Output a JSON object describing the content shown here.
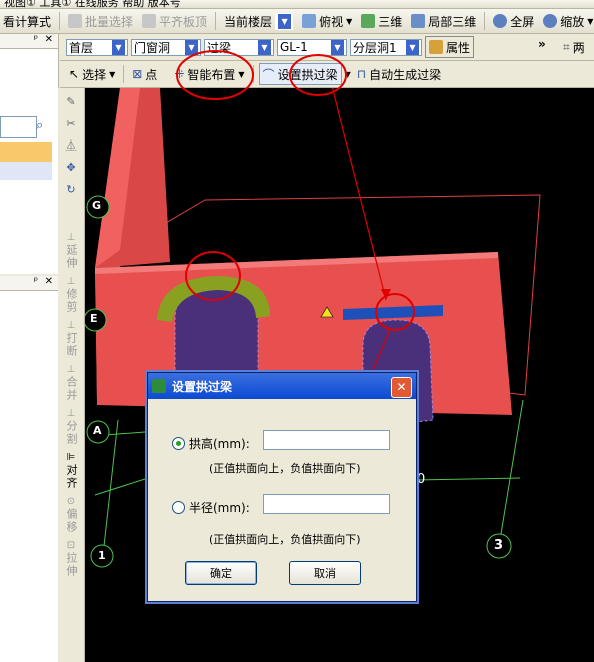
{
  "menu": {
    "text": "视图①  工具①  在线服务  帮助 版本号"
  },
  "toolbar1": {
    "calc_label": "看计算式",
    "batch_select": "批量选择",
    "level_slab": "平齐板顶",
    "floor_combo": "当前楼层",
    "view_label": "俯视",
    "view3d_label": "三维",
    "partial3d_label": "局部三维",
    "fullscreen_label": "全屏",
    "zoom_label": "缩放"
  },
  "toolbar2": {
    "floor": "首层",
    "category": "门窗洞",
    "element_type": "过梁",
    "element_name": "GL-1",
    "layer": "分层洞1",
    "props_label": "属性",
    "two_label": "两"
  },
  "toolbar3": {
    "select_label": "选择",
    "point_label": "点",
    "smart_place_label": "智能布置",
    "arch_beam_label": "设置拱过梁",
    "auto_gen_label": "自动生成过梁"
  },
  "side_tools": [
    {
      "label": "延伸",
      "active": false
    },
    {
      "label": "修剪",
      "active": false
    },
    {
      "label": "打断",
      "active": false
    },
    {
      "label": "合并",
      "active": false
    },
    {
      "label": "分割",
      "active": false
    },
    {
      "label": "对齐",
      "active": true
    },
    {
      "label": "偏移",
      "active": false
    },
    {
      "label": "拉伸",
      "active": false
    }
  ],
  "axis_labels": {
    "g": "G",
    "e": "E",
    "a": "A",
    "one": "1",
    "three": "3",
    "zero": "0"
  },
  "dialog": {
    "title": "设置拱过梁",
    "option_height": "拱高(mm):",
    "hint_height": "(正值拱面向上，负值拱面向下)",
    "option_radius": "半径(mm):",
    "hint_radius": "(正值拱面向上，负值拱面向下)",
    "height_value": "",
    "radius_value": "",
    "ok_label": "确定",
    "cancel_label": "取消"
  },
  "colors": {
    "wall": "#e8504f",
    "opening": "#4a2f7a",
    "arch": "#8aa021",
    "beam": "#1f4fb8",
    "annotation": "#e00000",
    "viewport": "#000000"
  }
}
